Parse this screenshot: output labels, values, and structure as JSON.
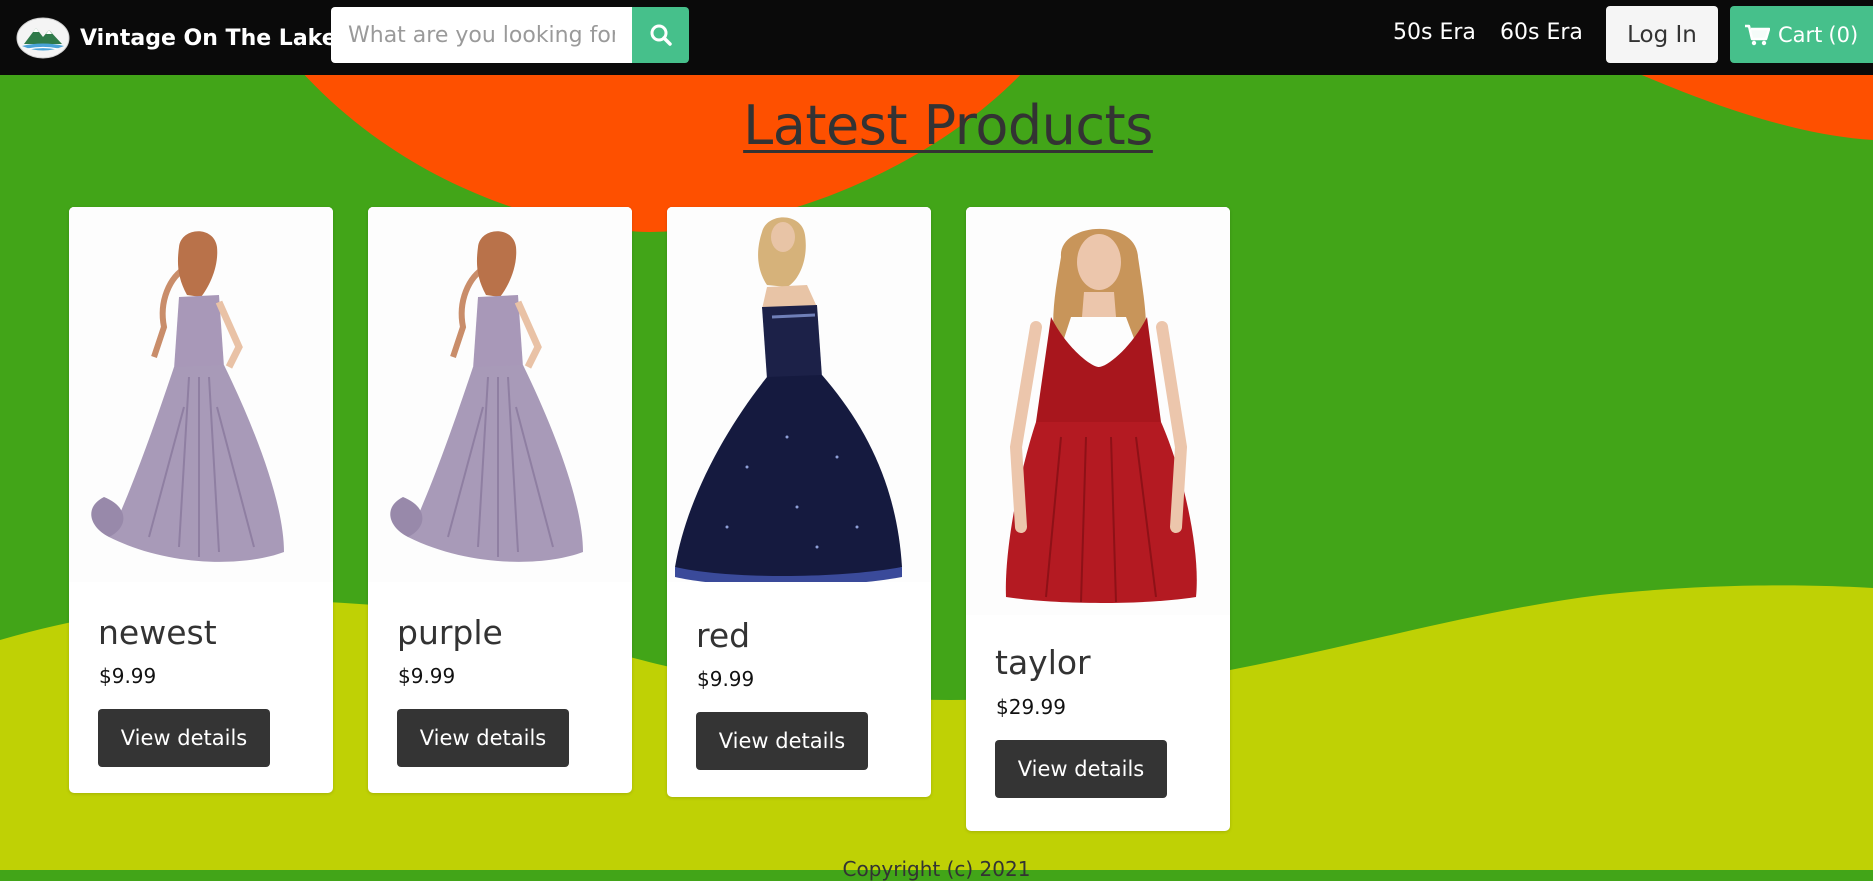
{
  "navbar": {
    "brand_name": "Vintage On The Lake",
    "search_placeholder": "What are you looking for?",
    "links": [
      "50s Era",
      "60s Era"
    ],
    "login_label": "Log In",
    "cart_label": "Cart",
    "cart_count": "(0)"
  },
  "main": {
    "heading": "Latest Products",
    "products": [
      {
        "name": "newest",
        "price": "$9.99",
        "button": "View details",
        "image": "lavender-gown"
      },
      {
        "name": "purple",
        "price": "$9.99",
        "button": "View details",
        "image": "lavender-gown"
      },
      {
        "name": "red",
        "price": "$9.99",
        "button": "View details",
        "image": "navy-ball-gown"
      },
      {
        "name": "taylor",
        "price": "$29.99",
        "button": "View details",
        "image": "red-dress"
      }
    ]
  },
  "footer": {
    "text": "Copyright (c) 2021"
  },
  "colors": {
    "navbar": "#0a0a0a",
    "accent": "#46c08b",
    "background_green": "#42a518",
    "background_orange": "#fe5000",
    "background_lime": "#bfd105",
    "button_dark": "#343434"
  },
  "icons": [
    "logo-mountain-icon",
    "search-icon",
    "cart-icon"
  ]
}
